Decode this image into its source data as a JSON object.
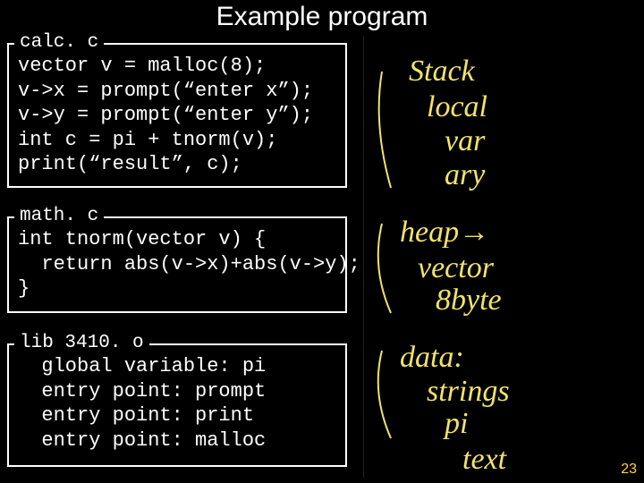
{
  "title": "Example program",
  "page_number": "23",
  "boxes": {
    "calc": {
      "label": "calc. c",
      "code": "vector v = malloc(8);\nv->x = prompt(“enter x”);\nv->y = prompt(“enter y”);\nint c = pi + tnorm(v);\nprint(“result”, c);"
    },
    "math": {
      "label": "math. c",
      "code": "int tnorm(vector v) {\n  return abs(v->x)+abs(v->y);\n}"
    },
    "lib": {
      "label": "lib 3410. o",
      "code": "  global variable: pi\n  entry point: prompt\n  entry point: print\n  entry point: malloc"
    }
  },
  "handwriting": {
    "line1": "Stack",
    "line2": "local",
    "line3": "var",
    "line4": "ary",
    "line5": "heap→",
    "line6": "vector",
    "line7": "8byte",
    "line8": "data:",
    "line9": "strings",
    "line10": "pi",
    "line11": "text"
  }
}
